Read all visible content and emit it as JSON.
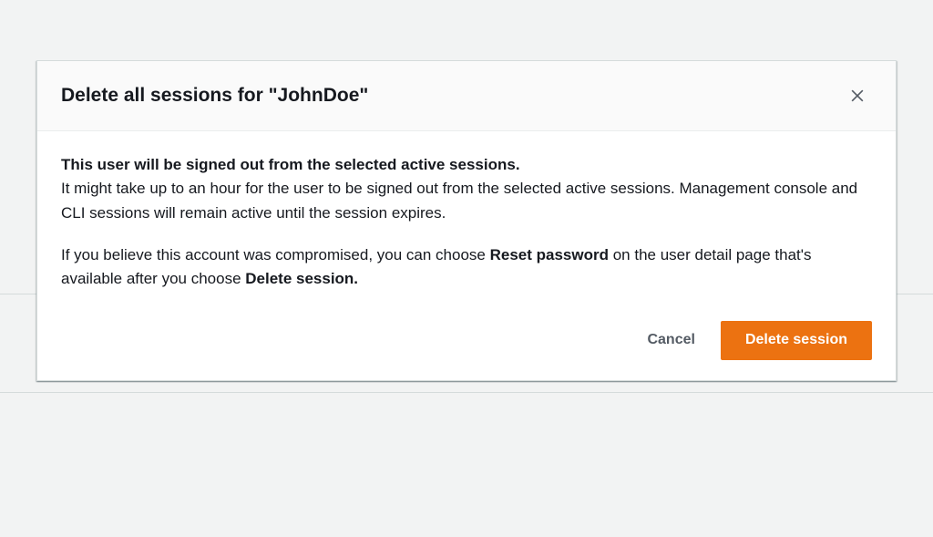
{
  "modal": {
    "title": "Delete all sessions for \"JohnDoe\"",
    "body": {
      "p1_bold": "This user will be signed out from the selected active sessions.",
      "p1_text": "It might take up to an hour for the user to be signed out from the selected active sessions. Management console and CLI sessions will remain active until the session expires.",
      "p2_before": "If you believe this account was compromised, you can choose ",
      "p2_bold1": "Reset password",
      "p2_mid": " on the user detail page that's available after you choose ",
      "p2_bold2": "Delete session."
    },
    "buttons": {
      "cancel": "Cancel",
      "confirm": "Delete session"
    }
  }
}
